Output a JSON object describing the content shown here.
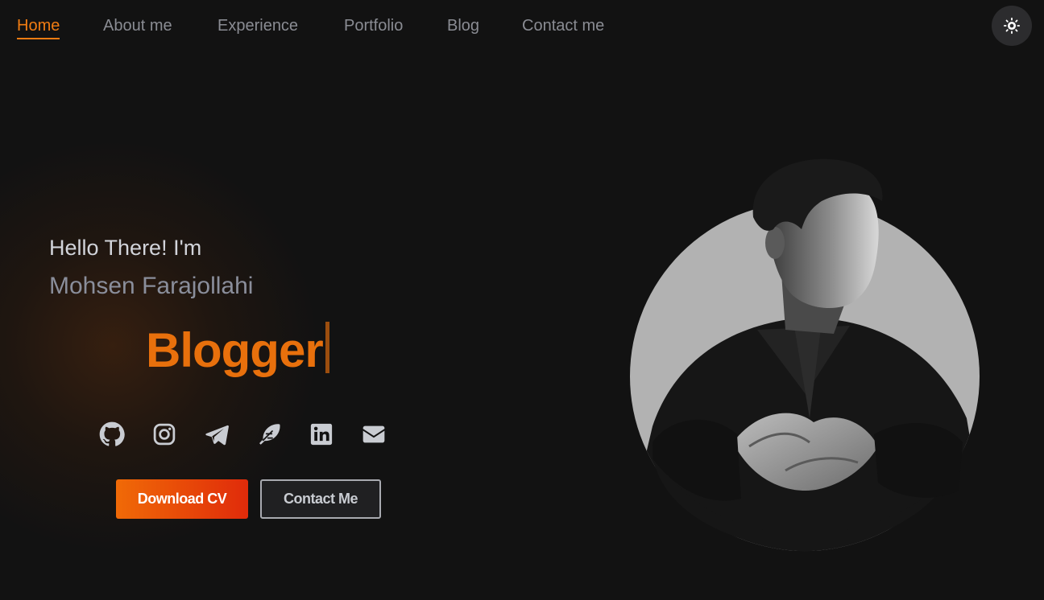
{
  "nav": {
    "items": [
      {
        "label": "Home",
        "active": true
      },
      {
        "label": "About me",
        "active": false
      },
      {
        "label": "Experience",
        "active": false
      },
      {
        "label": "Portfolio",
        "active": false
      },
      {
        "label": "Blog",
        "active": false
      },
      {
        "label": "Contact me",
        "active": false
      }
    ],
    "theme_toggle_icon": "sun-icon"
  },
  "hero": {
    "greeting": "Hello There! I'm",
    "name": "Mohsen Farajollahi",
    "role": "Blogger"
  },
  "socials": [
    {
      "icon": "github-icon"
    },
    {
      "icon": "instagram-icon"
    },
    {
      "icon": "telegram-icon"
    },
    {
      "icon": "feather-icon"
    },
    {
      "icon": "linkedin-icon"
    },
    {
      "icon": "email-icon"
    }
  ],
  "buttons": {
    "download_cv": "Download CV",
    "contact_me": "Contact Me"
  },
  "colors": {
    "accent": "#f07c12",
    "background": "#121212",
    "nav_text": "#8a8c93"
  }
}
